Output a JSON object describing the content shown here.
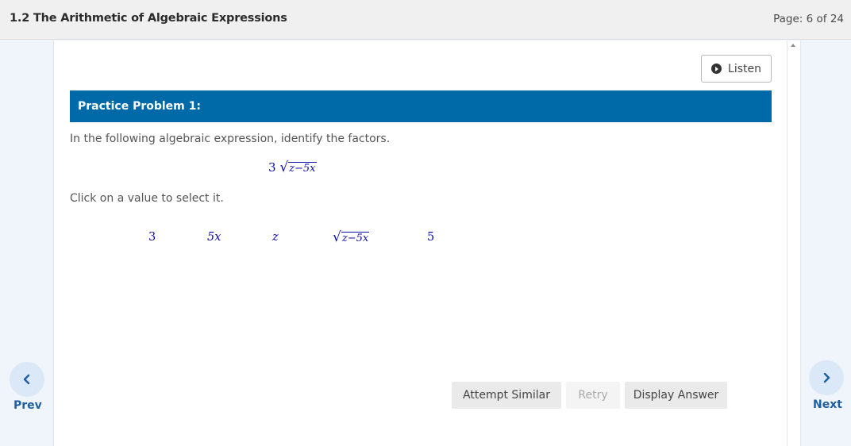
{
  "header": {
    "title": "1.2 The Arithmetic of Algebraic Expressions",
    "page_indicator": "Page: 6 of 24"
  },
  "nav": {
    "prev_label": "Prev",
    "next_label": "Next"
  },
  "listen": {
    "label": "Listen"
  },
  "problem": {
    "heading": "Practice Problem 1:",
    "instruction": "In the following algebraic expression, identify the factors.",
    "expression": {
      "coefficient": "3",
      "radicand": "z−5x"
    },
    "click_hint": "Click on a value to select it.",
    "choices": [
      "3",
      "5x",
      "z",
      "z−5x",
      "5"
    ]
  },
  "actions": {
    "attempt_similar": "Attempt Similar",
    "retry": "Retry",
    "display_answer": "Display Answer"
  },
  "colors": {
    "header_bar": "#006aa8",
    "math_blue": "#0b0bb0",
    "nav_blue": "#1f5fa0"
  }
}
